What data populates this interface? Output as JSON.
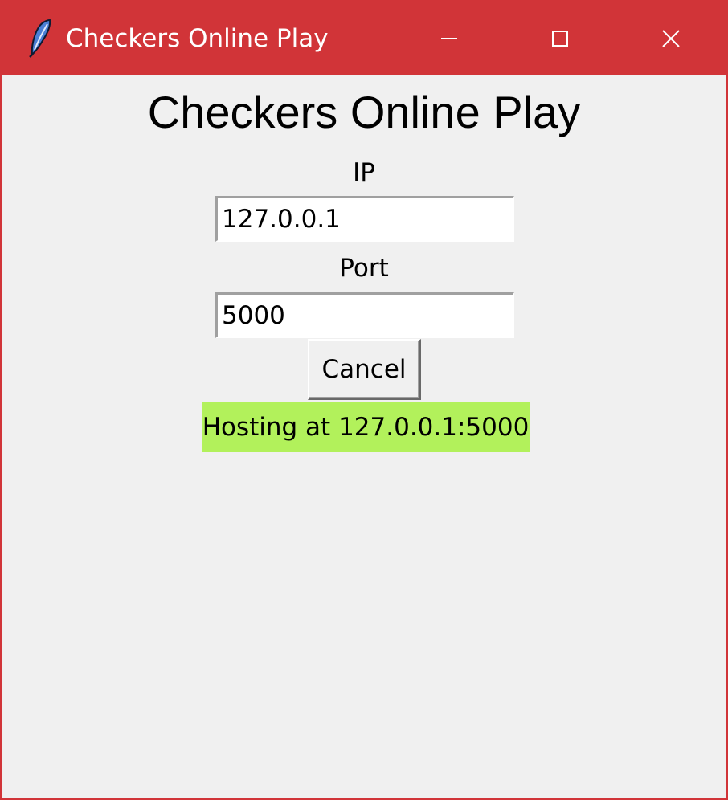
{
  "window": {
    "title": "Checkers Online Play",
    "icon": "feather-icon",
    "controls": {
      "minimize": "minimize-icon",
      "maximize": "maximize-icon",
      "close": "close-icon"
    },
    "accent_color": "#d13438"
  },
  "main": {
    "heading": "Checkers Online Play",
    "ip_label": "IP",
    "ip_value": "127.0.0.1",
    "port_label": "Port",
    "port_value": "5000",
    "cancel_label": "Cancel",
    "status_text": "Hosting at 127.0.0.1:5000",
    "status_color": "#b2f15b"
  }
}
